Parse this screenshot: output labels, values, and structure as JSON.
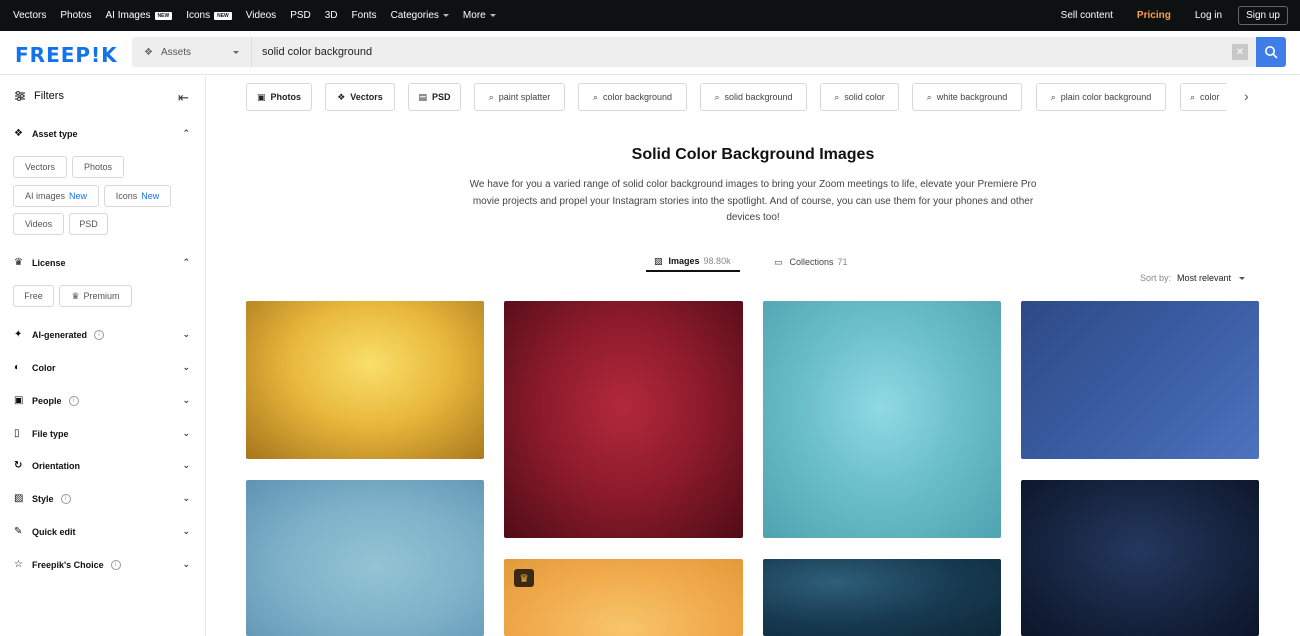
{
  "topnav": {
    "items": [
      "Vectors",
      "Photos",
      "AI Images",
      "Icons",
      "Videos",
      "PSD",
      "3D",
      "Fonts",
      "Categories",
      "More"
    ],
    "new_badge": "NEW",
    "sell": "Sell content",
    "pricing": "Pricing",
    "login": "Log in",
    "signup": "Sign up",
    "pricing_color": "#ff9b4e"
  },
  "header": {
    "logo": "FREEP!K",
    "assets_label": "Assets",
    "search_value": "solid color background",
    "clear_icon": "close-icon",
    "accent": "#3f7ee8"
  },
  "sidebar": {
    "title": "Filters",
    "asset_type": {
      "label": "Asset type",
      "chips": [
        "Vectors",
        "Photos",
        "AI images",
        "Icons",
        "Videos",
        "PSD"
      ],
      "new_label": "New"
    },
    "license": {
      "label": "License",
      "chips": [
        "Free",
        "Premium"
      ]
    },
    "sections": [
      "AI-generated",
      "Color",
      "People",
      "File type",
      "Orientation",
      "Style",
      "Quick edit",
      "Freepik's Choice"
    ]
  },
  "tags": [
    "Photos",
    "Vectors",
    "PSD",
    "paint splatter",
    "color background",
    "solid background",
    "solid color",
    "white background",
    "plain color background",
    "color"
  ],
  "main": {
    "title": "Solid Color Background Images",
    "description": "We have for you a varied range of solid color background images to bring your Zoom meetings to life, elevate your Premiere Pro movie projects and propel your Instagram stories into the spotlight. And of course, you can use them for your phones and other devices too!",
    "tabs": [
      {
        "label": "Images",
        "count": "98.80k"
      },
      {
        "label": "Collections",
        "count": "71"
      }
    ],
    "sort_label": "Sort by:",
    "sort_value": "Most relevant"
  }
}
